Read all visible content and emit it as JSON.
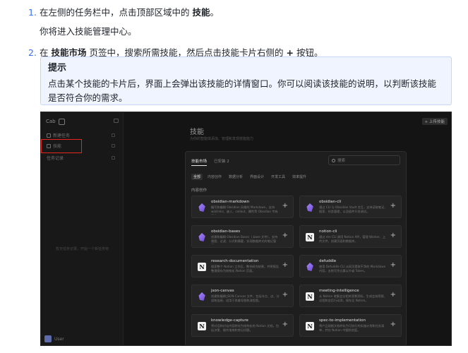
{
  "instructions": {
    "step1": {
      "num": "1.",
      "pre": "在左侧的任务栏中，点击顶部区域中的",
      "bold": "技能",
      "post": "。",
      "sub": "你将进入技能管理中心。"
    },
    "step2": {
      "num": "2.",
      "pre": "在",
      "bold": "技能市场",
      "mid": "页签中，搜索所需技能，然后点击技能卡片右侧的",
      "bold2": "+",
      "post": "按钮。"
    }
  },
  "tip": {
    "title": "提示",
    "text": "点击某个技能的卡片后，界面上会弹出该技能的详情窗口。你可以阅读该技能的说明，以判断该技能是否符合你的需求。"
  },
  "screenshot": {
    "sidebar": {
      "app_name": "Cab",
      "new_task": "新建任务",
      "skills": "技能",
      "tasks": "任务记录",
      "empty_hint": "暂无任务记录，开始一个新任务吧",
      "user": "User"
    },
    "upload_button": "+ 上传技能",
    "page_title": "技能",
    "page_subtitle": "为你的智能体添加、管理和发现技能能力",
    "modal": {
      "tab_market": "技能市场",
      "tab_installed": "已安装",
      "installed_count": "2",
      "search_placeholder": "搜索",
      "chips": [
        "全部",
        "内容创作",
        "数据分析",
        "界面设计",
        "开发工具",
        "效率提升"
      ],
      "section_title": "内容创作",
      "cards": [
        {
          "name": "obsidian-markdown",
          "desc": "编写和编辑 Obsidian 风格的 Markdown，支持 wikilinks、嵌入、callout、属性等 Obsidian 专有语法。",
          "icon": "obsidian"
        },
        {
          "name": "obsidian-cli",
          "desc": "通过 CLI 与 Obsidian Vault 交互，支持读取笔记、搜索、任务管理，以及插件开发调试。",
          "icon": "obsidian"
        },
        {
          "name": "obsidian-bases",
          "desc": "创建和编辑 Obsidian Bases（.base 文件），支持视图、过滤、公式和摘要，实现数据库式的笔记管理。",
          "icon": "obsidian"
        },
        {
          "name": "notion-cli",
          "desc": "通过 ntn CLI 调用 Notion API，管理 Worker、上传文件，创建页面和数据库。",
          "icon": "notion"
        },
        {
          "name": "research-documentation",
          "desc": "搜索整个 Notion 工作区，整合研究结果，并将报告整理保存为结构化 Notion 页面。",
          "icon": "notion"
        },
        {
          "name": "defuddle",
          "desc": "使用 Defuddle CLI 从网页提取干净的 Markdown 内容，去除冗余元素以节省 Token。",
          "icon": "obsidian"
        },
        {
          "name": "json-canvas",
          "desc": "创建和编辑 JSON Canvas 文件，包括节点、边、分组和连接，适用于思维导图和流程图。",
          "icon": "obsidian"
        },
        {
          "name": "meeting-intelligence",
          "desc": "从 Notion 收集会议相关背景资料，生成会前简报、议程和会后行动项，保存至 Notion。",
          "icon": "notion"
        },
        {
          "name": "knowledge-capture",
          "desc": "将对话和讨论内容转化为结构化的 Notion 文档，包括决策、操作指南和常见问题。",
          "icon": "notion"
        },
        {
          "name": "spec-to-implementation",
          "desc": "将产品规格文档转化为可执行的实施计划和任务清单，并在 Notion 中跟踪进度。",
          "icon": "notion"
        }
      ],
      "card_action": "+"
    }
  }
}
